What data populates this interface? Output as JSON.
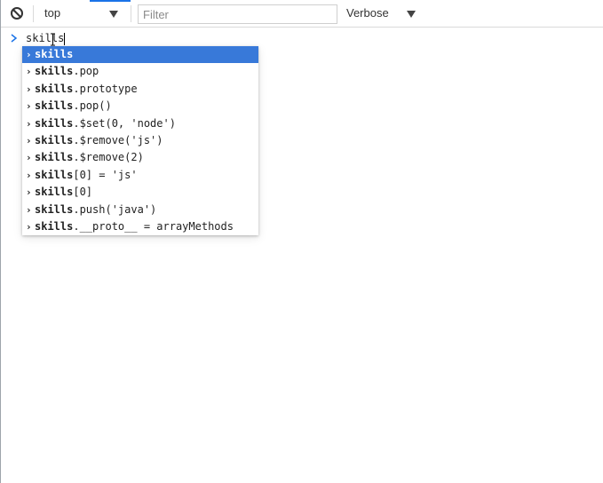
{
  "toolbar": {
    "context_value": "top",
    "filter_placeholder": "Filter",
    "filter_value": "",
    "level_value": "Verbose"
  },
  "console": {
    "prompt_text": "skills"
  },
  "autocomplete": {
    "items": [
      {
        "prefix": "skills",
        "rest": "",
        "selected": true
      },
      {
        "prefix": "skills",
        "rest": ".pop",
        "selected": false
      },
      {
        "prefix": "skills",
        "rest": ".prototype",
        "selected": false
      },
      {
        "prefix": "skills",
        "rest": ".pop()",
        "selected": false
      },
      {
        "prefix": "skills",
        "rest": ".$set(0, 'node')",
        "selected": false
      },
      {
        "prefix": "skills",
        "rest": ".$remove('js')",
        "selected": false
      },
      {
        "prefix": "skills",
        "rest": ".$remove(2)",
        "selected": false
      },
      {
        "prefix": "skills",
        "rest": "[0] = 'js'",
        "selected": false
      },
      {
        "prefix": "skills",
        "rest": "[0]",
        "selected": false
      },
      {
        "prefix": "skills",
        "rest": ".push('java')",
        "selected": false
      },
      {
        "prefix": "skills",
        "rest": ".__proto__ = arrayMethods",
        "selected": false
      }
    ]
  },
  "colors": {
    "selection": "#3879d9",
    "tab_accent": "#1a73e8"
  },
  "icons": {
    "clear": "clear-console-icon",
    "context_caret": "chevron-down-icon",
    "level_caret": "chevron-down-icon",
    "prompt": "prompt-chevron-icon"
  }
}
